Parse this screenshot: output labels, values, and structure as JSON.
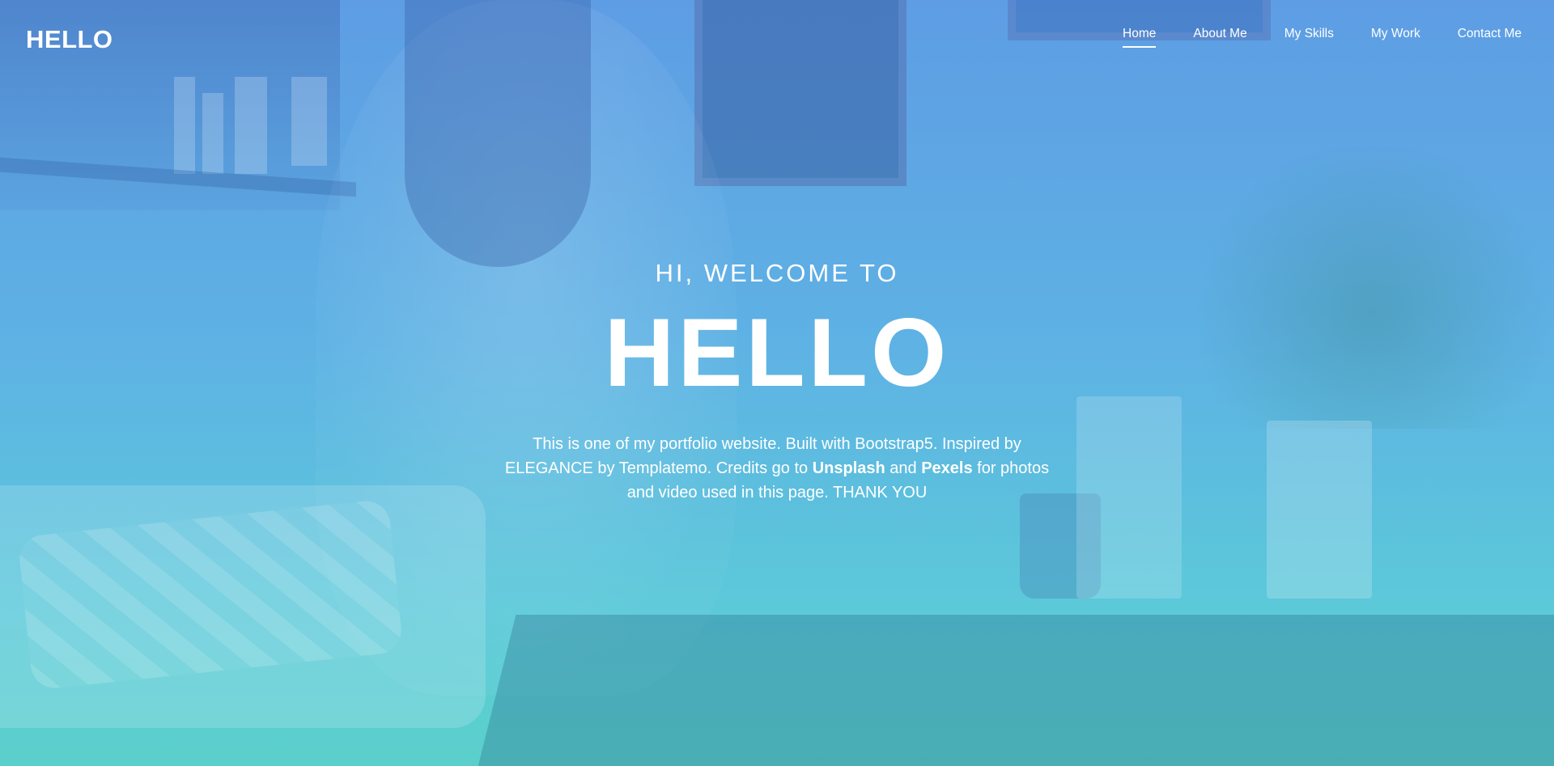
{
  "navbar": {
    "brand": "HELLO",
    "links": [
      {
        "label": "Home",
        "active": true
      },
      {
        "label": "About Me",
        "active": false
      },
      {
        "label": "My Skills",
        "active": false
      },
      {
        "label": "My Work",
        "active": false
      },
      {
        "label": "Contact Me",
        "active": false
      }
    ]
  },
  "hero": {
    "subtitle": "HI, WELCOME TO",
    "title": "HELLO",
    "description": {
      "part1": "This is one of my portfolio website. Built with Bootstrap5. Inspired by ELEGANCE by Templatemo. Credits go to ",
      "bold1": "Unsplash",
      "part2": " and ",
      "bold2": "Pexels",
      "part3": " for photos and video used in this page. THANK YOU"
    }
  },
  "colors": {
    "overlay_top": "#5f9fe3",
    "overlay_bottom": "#5bcfc9",
    "text": "#ffffff"
  }
}
